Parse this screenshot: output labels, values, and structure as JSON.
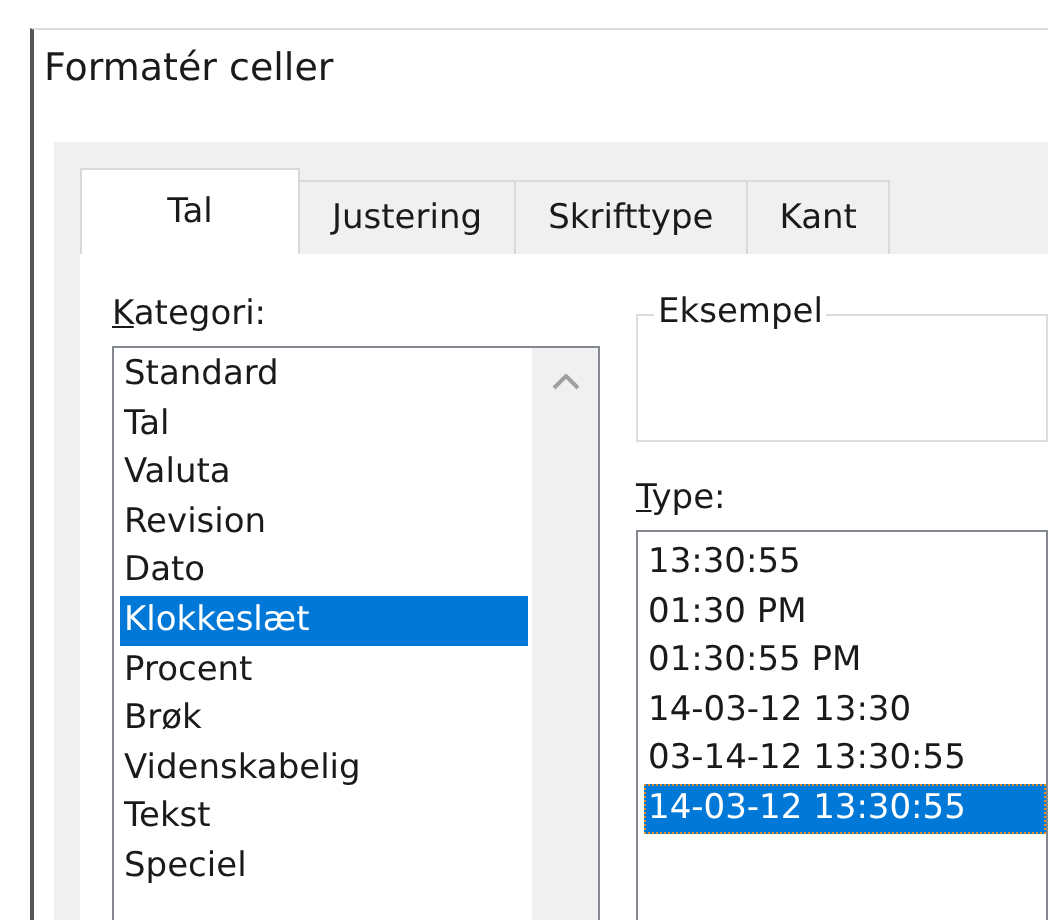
{
  "window": {
    "title": "Formatér celler"
  },
  "tabs": [
    {
      "label": "Tal",
      "selected": true
    },
    {
      "label": "Justering",
      "selected": false
    },
    {
      "label": "Skrifttype",
      "selected": false
    },
    {
      "label": "Kant",
      "selected": false
    }
  ],
  "category": {
    "label": "Kategori:",
    "items": [
      {
        "label": "Standard",
        "selected": false
      },
      {
        "label": "Tal",
        "selected": false
      },
      {
        "label": "Valuta",
        "selected": false
      },
      {
        "label": "Revision",
        "selected": false
      },
      {
        "label": "Dato",
        "selected": false
      },
      {
        "label": "Klokkeslæt",
        "selected": true
      },
      {
        "label": "Procent",
        "selected": false
      },
      {
        "label": "Brøk",
        "selected": false
      },
      {
        "label": "Videnskabelig",
        "selected": false
      },
      {
        "label": "Tekst",
        "selected": false
      },
      {
        "label": "Speciel",
        "selected": false
      }
    ]
  },
  "sample": {
    "label": "Eksempel"
  },
  "type": {
    "label": "Type:",
    "items": [
      {
        "label": "13:30:55",
        "selected": false
      },
      {
        "label": "01:30 PM",
        "selected": false
      },
      {
        "label": "01:30:55 PM",
        "selected": false
      },
      {
        "label": "14-03-12 13:30",
        "selected": false
      },
      {
        "label": "03-14-12 13:30:55",
        "selected": false
      },
      {
        "label": "14-03-12 13:30:55",
        "selected": true
      }
    ]
  }
}
